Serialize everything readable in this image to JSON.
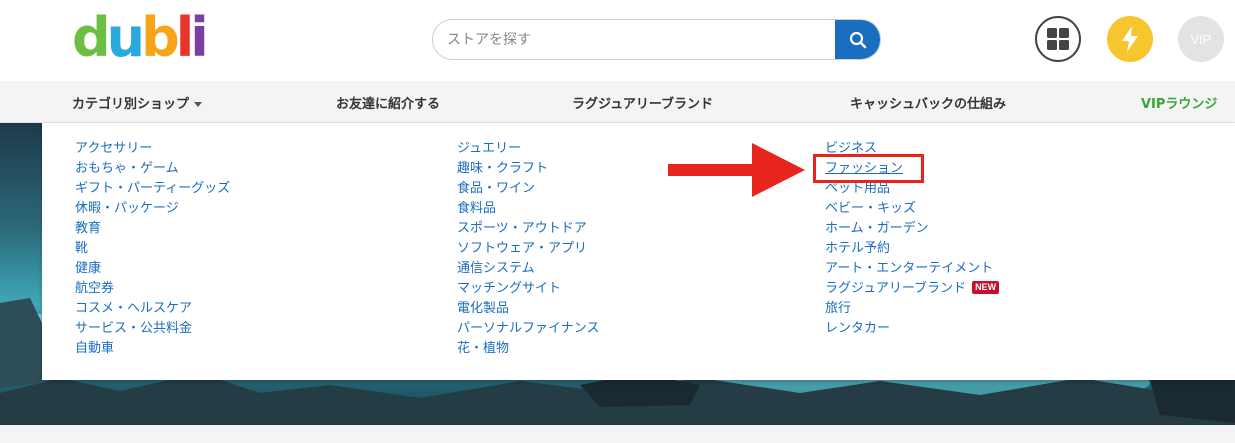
{
  "header": {
    "logo_letters": [
      "d",
      "u",
      "b",
      "l",
      "i"
    ],
    "logo_colors": [
      "#6cbf43",
      "#2aa8e0",
      "#f6a51a",
      "#e8352a",
      "#7a3fa0"
    ],
    "search_placeholder": "ストアを探す",
    "vip_label": "VIP"
  },
  "nav": {
    "items": [
      {
        "label": "カテゴリ別ショップ"
      },
      {
        "label": "お友達に紹介する"
      },
      {
        "label": "ラグジュアリーブランド"
      },
      {
        "label": "キャッシュバックの仕組み"
      },
      {
        "label": "VIPラウンジ"
      }
    ]
  },
  "categories": {
    "col1": [
      "アクセサリー",
      "おもちゃ・ゲーム",
      "ギフト・パーティーグッズ",
      "休暇・パッケージ",
      "教育",
      "靴",
      "健康",
      "航空券",
      "コスメ・ヘルスケア",
      "サービス・公共料金",
      "自動車"
    ],
    "col2": [
      "ジュエリー",
      "趣味・クラフト",
      "食品・ワイン",
      "食料品",
      "スポーツ・アウトドア",
      "ソフトウェア・アプリ",
      "通信システム",
      "マッチングサイト",
      "電化製品",
      "パーソナルファイナンス",
      "花・植物"
    ],
    "col3": [
      "ビジネス",
      "ファッション",
      "ペット用品",
      "ベビー・キッズ",
      "ホーム・ガーデン",
      "ホテル予約",
      "アート・エンターテイメント",
      "ラグジュアリーブランド",
      "旅行",
      "レンタカー"
    ],
    "new_badge": "NEW",
    "highlighted": "ファッション"
  },
  "colors": {
    "link": "#1a6ec0",
    "highlight": "#e8251c",
    "vip_nav": "#3aa535",
    "search_button": "#1a6ec0"
  }
}
